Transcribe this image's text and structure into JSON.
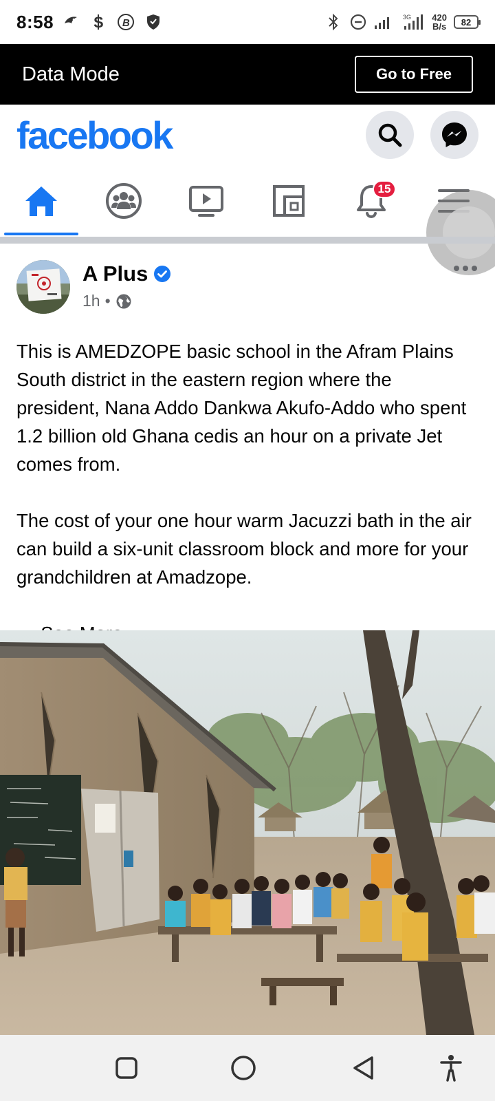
{
  "status_bar": {
    "time": "8:58",
    "net_speed_value": "420",
    "net_speed_unit": "B/s",
    "network_type": "3G",
    "battery_level": "82"
  },
  "banner": {
    "title": "Data Mode",
    "button_label": "Go to Free"
  },
  "header": {
    "logo": "facebook"
  },
  "nav": {
    "tabs": [
      {
        "name": "home",
        "active": true
      },
      {
        "name": "groups",
        "active": false
      },
      {
        "name": "watch",
        "active": false
      },
      {
        "name": "marketplace",
        "active": false
      },
      {
        "name": "notifications",
        "active": false,
        "badge": "15"
      },
      {
        "name": "menu",
        "active": false
      }
    ],
    "notification_badge": "15"
  },
  "post": {
    "author": "A Plus",
    "verified": true,
    "time": "1h",
    "separator": "•",
    "audience": "public",
    "paragraph1": "This is AMEDZOPE basic school in the Afram Plains South district in the eastern region where the president, Nana Addo Dankwa Akufo-Addo who spent 1.2 billion old Ghana cedis an hour on a private Jet comes from.",
    "paragraph2": "The cost of your one hour warm Jacuzzi bath in the air can build a six-unit classroom block and more for your grandchildren at Amadzope.",
    "ellipsis": "… ",
    "see_more": "See More"
  },
  "colors": {
    "brand": "#1877f2",
    "badge": "#e41e3f",
    "banner_bg": "#000000",
    "secondary_text": "#65676b"
  }
}
